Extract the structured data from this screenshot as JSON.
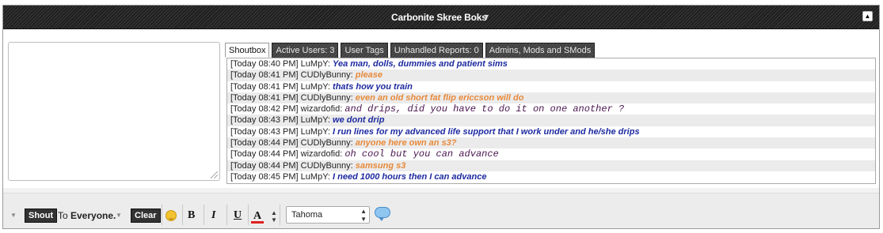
{
  "title": "Carbonite Skree Boks",
  "title_caret_icon": "chevron-down-icon",
  "collapse_icon": "collapse-up-icon",
  "tabs": [
    {
      "label": "Shoutbox",
      "active": true
    },
    {
      "label": "Active Users: 3",
      "active": false
    },
    {
      "label": "User Tags",
      "active": false
    },
    {
      "label": "Unhandled Reports: 0",
      "active": false
    },
    {
      "label": "Admins, Mods and SMods",
      "active": false
    }
  ],
  "messages": [
    {
      "time": "[Today 08:40 PM]",
      "user": "LuMpY:",
      "text": "Yea man, dolls, dummies and patient sims",
      "style": "lumpy"
    },
    {
      "time": "[Today 08:41 PM]",
      "user": "CUDlyBunny:",
      "text": "please",
      "style": "bunny"
    },
    {
      "time": "[Today 08:41 PM]",
      "user": "LuMpY:",
      "text": "thats how you train",
      "style": "lumpy"
    },
    {
      "time": "[Today 08:41 PM]",
      "user": "CUDlyBunny:",
      "text": "even an old short fat flip ericcson will do",
      "style": "bunny"
    },
    {
      "time": "[Today 08:42 PM]",
      "user": "wizardofid:",
      "text": "and drips, did you have to do it on one another ?",
      "style": "wizard"
    },
    {
      "time": "[Today 08:43 PM]",
      "user": "LuMpY:",
      "text": "we dont drip",
      "style": "lumpy"
    },
    {
      "time": "[Today 08:43 PM]",
      "user": "LuMpY:",
      "text": "I run lines for my advanced life support that I work under and he/she drips",
      "style": "lumpy"
    },
    {
      "time": "[Today 08:44 PM]",
      "user": "CUDlyBunny:",
      "text": "anyone here own an s3?",
      "style": "bunny"
    },
    {
      "time": "[Today 08:44 PM]",
      "user": "wizardofid:",
      "text": "oh cool but you can advance",
      "style": "wizard"
    },
    {
      "time": "[Today 08:44 PM]",
      "user": "CUDlyBunny:",
      "text": "samsung s3",
      "style": "bunny"
    },
    {
      "time": "[Today 08:45 PM]",
      "user": "LuMpY:",
      "text": "I need 1000 hours then I can advance",
      "style": "lumpy"
    }
  ],
  "toolbar": {
    "shout_label": "Shout",
    "to_label": "To",
    "target_label": "Everyone.",
    "clear_label": "Clear",
    "bold_label": "B",
    "italic_label": "I",
    "underline_label": "U",
    "color_label": "A",
    "font_value": "Tahoma",
    "font_arrows": "▲▼"
  },
  "colors": {
    "lumpy": "#1d2aa0",
    "bunny": "#e8893a",
    "wizard": "#4a1550",
    "font_color": "#e02020"
  }
}
